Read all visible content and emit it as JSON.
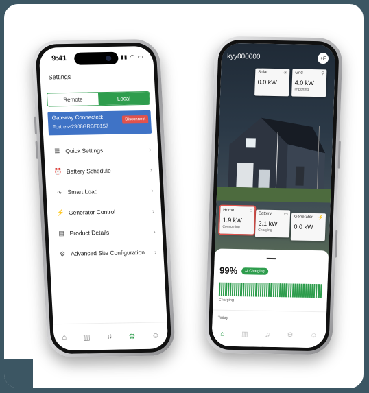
{
  "left_phone": {
    "time": "9:41",
    "status_icons": "▮▮ ◠ ▭",
    "title": "Settings",
    "segment": {
      "remote": "Remote",
      "local": "Local"
    },
    "gateway": {
      "title": "Gateway Connected:",
      "serial": "Fortress2308GRBF0157",
      "disconnect_label": "Disconnect"
    },
    "menu": [
      {
        "icon": "list-icon",
        "glyph": "☰",
        "label": "Quick Settings",
        "chevron": "›"
      },
      {
        "icon": "clock-icon",
        "glyph": "⏰",
        "label": "Battery Schedule",
        "chevron": "›"
      },
      {
        "icon": "wave-icon",
        "glyph": "∿",
        "label": "Smart Load",
        "chevron": "›"
      },
      {
        "icon": "bolt-icon",
        "glyph": "⚡",
        "label": "Generator Control",
        "chevron": "›"
      },
      {
        "icon": "document-icon",
        "glyph": "▤",
        "label": "Product Details",
        "chevron": "›"
      },
      {
        "icon": "sliders-icon",
        "glyph": "⚙",
        "label": "Advanced Site Configuration",
        "chevron": "›"
      }
    ],
    "tabs": [
      {
        "name": "home-icon",
        "glyph": "⌂"
      },
      {
        "name": "chart-icon",
        "glyph": "▥"
      },
      {
        "name": "bell-icon",
        "glyph": "♫"
      },
      {
        "name": "gear-icon",
        "glyph": "⚙"
      },
      {
        "name": "user-icon",
        "glyph": "☺"
      }
    ]
  },
  "right_phone": {
    "site_name": "kyy000000",
    "avatar": "+F",
    "cards": {
      "solar": {
        "label": "Solar",
        "value": "0.0 kW",
        "sub": "",
        "icon": "☀"
      },
      "grid": {
        "label": "Grid",
        "value": "4.0 kW",
        "sub": "Importing",
        "icon": "⚲"
      },
      "home": {
        "label": "Home",
        "value": "1.9 kW",
        "sub": "Consuming",
        "icon": "⌂"
      },
      "battery": {
        "label": "Battery",
        "value": "2.1 kW",
        "sub": "Charging",
        "icon": "▭"
      },
      "generator": {
        "label": "Generator",
        "value": "0.0 kW",
        "sub": "",
        "icon": "⚡"
      }
    },
    "soc": "99%",
    "soc_fraction": 0.99,
    "badge": "⇄ Charging",
    "charging_label": "Charging",
    "today_label": "Today",
    "tabs": [
      {
        "name": "home-icon",
        "glyph": "⌂"
      },
      {
        "name": "chart-icon",
        "glyph": "▥"
      },
      {
        "name": "bell-icon",
        "glyph": "♫"
      },
      {
        "name": "gear-icon",
        "glyph": "⚙"
      },
      {
        "name": "user-icon",
        "glyph": "☺"
      }
    ]
  },
  "colors": {
    "accent": "#2e9d4d",
    "gateway": "#3f73c6",
    "danger": "#e0524c"
  }
}
